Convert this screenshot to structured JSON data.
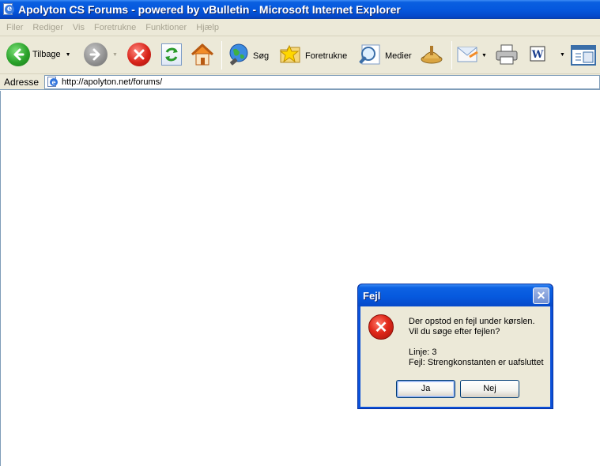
{
  "window": {
    "title": "Apolyton CS Forums - powered by vBulletin - Microsoft Internet Explorer"
  },
  "menu": {
    "items": [
      "Filer",
      "Rediger",
      "Vis",
      "Foretrukne",
      "Funktioner",
      "Hjælp"
    ]
  },
  "toolbar": {
    "back_label": "Tilbage",
    "search_label": "Søg",
    "favorites_label": "Foretrukne",
    "media_label": "Medier"
  },
  "address": {
    "label": "Adresse",
    "url": "http://apolyton.net/forums/"
  },
  "dialog": {
    "title": "Fejl",
    "close_glyph": "✕",
    "line1": "Der opstod en fejl under kørslen.",
    "line2": "Vil du søge efter fejlen?",
    "line3": "Linje: 3",
    "line4": "Fejl: Strengkonstanten er uafsluttet",
    "yes_label": "Ja",
    "no_label": "Nej"
  },
  "icons": {
    "app": "ie-page-icon",
    "back": "back-arrow-icon",
    "forward": "forward-arrow-icon",
    "stop": "stop-icon",
    "refresh": "refresh-icon",
    "home": "home-icon",
    "search": "search-globe-icon",
    "favorites": "favorites-star-icon",
    "media": "media-icon",
    "history": "history-icon",
    "mail": "mail-icon",
    "print": "print-icon",
    "edit": "word-edit-icon",
    "discuss": "discuss-icon",
    "error": "error-x-icon"
  },
  "colors": {
    "title_bar": "#0558de",
    "chrome": "#ece9d8",
    "back_green": "#2aa22a",
    "stop_red": "#d8231a",
    "error_red": "#e0281a"
  }
}
